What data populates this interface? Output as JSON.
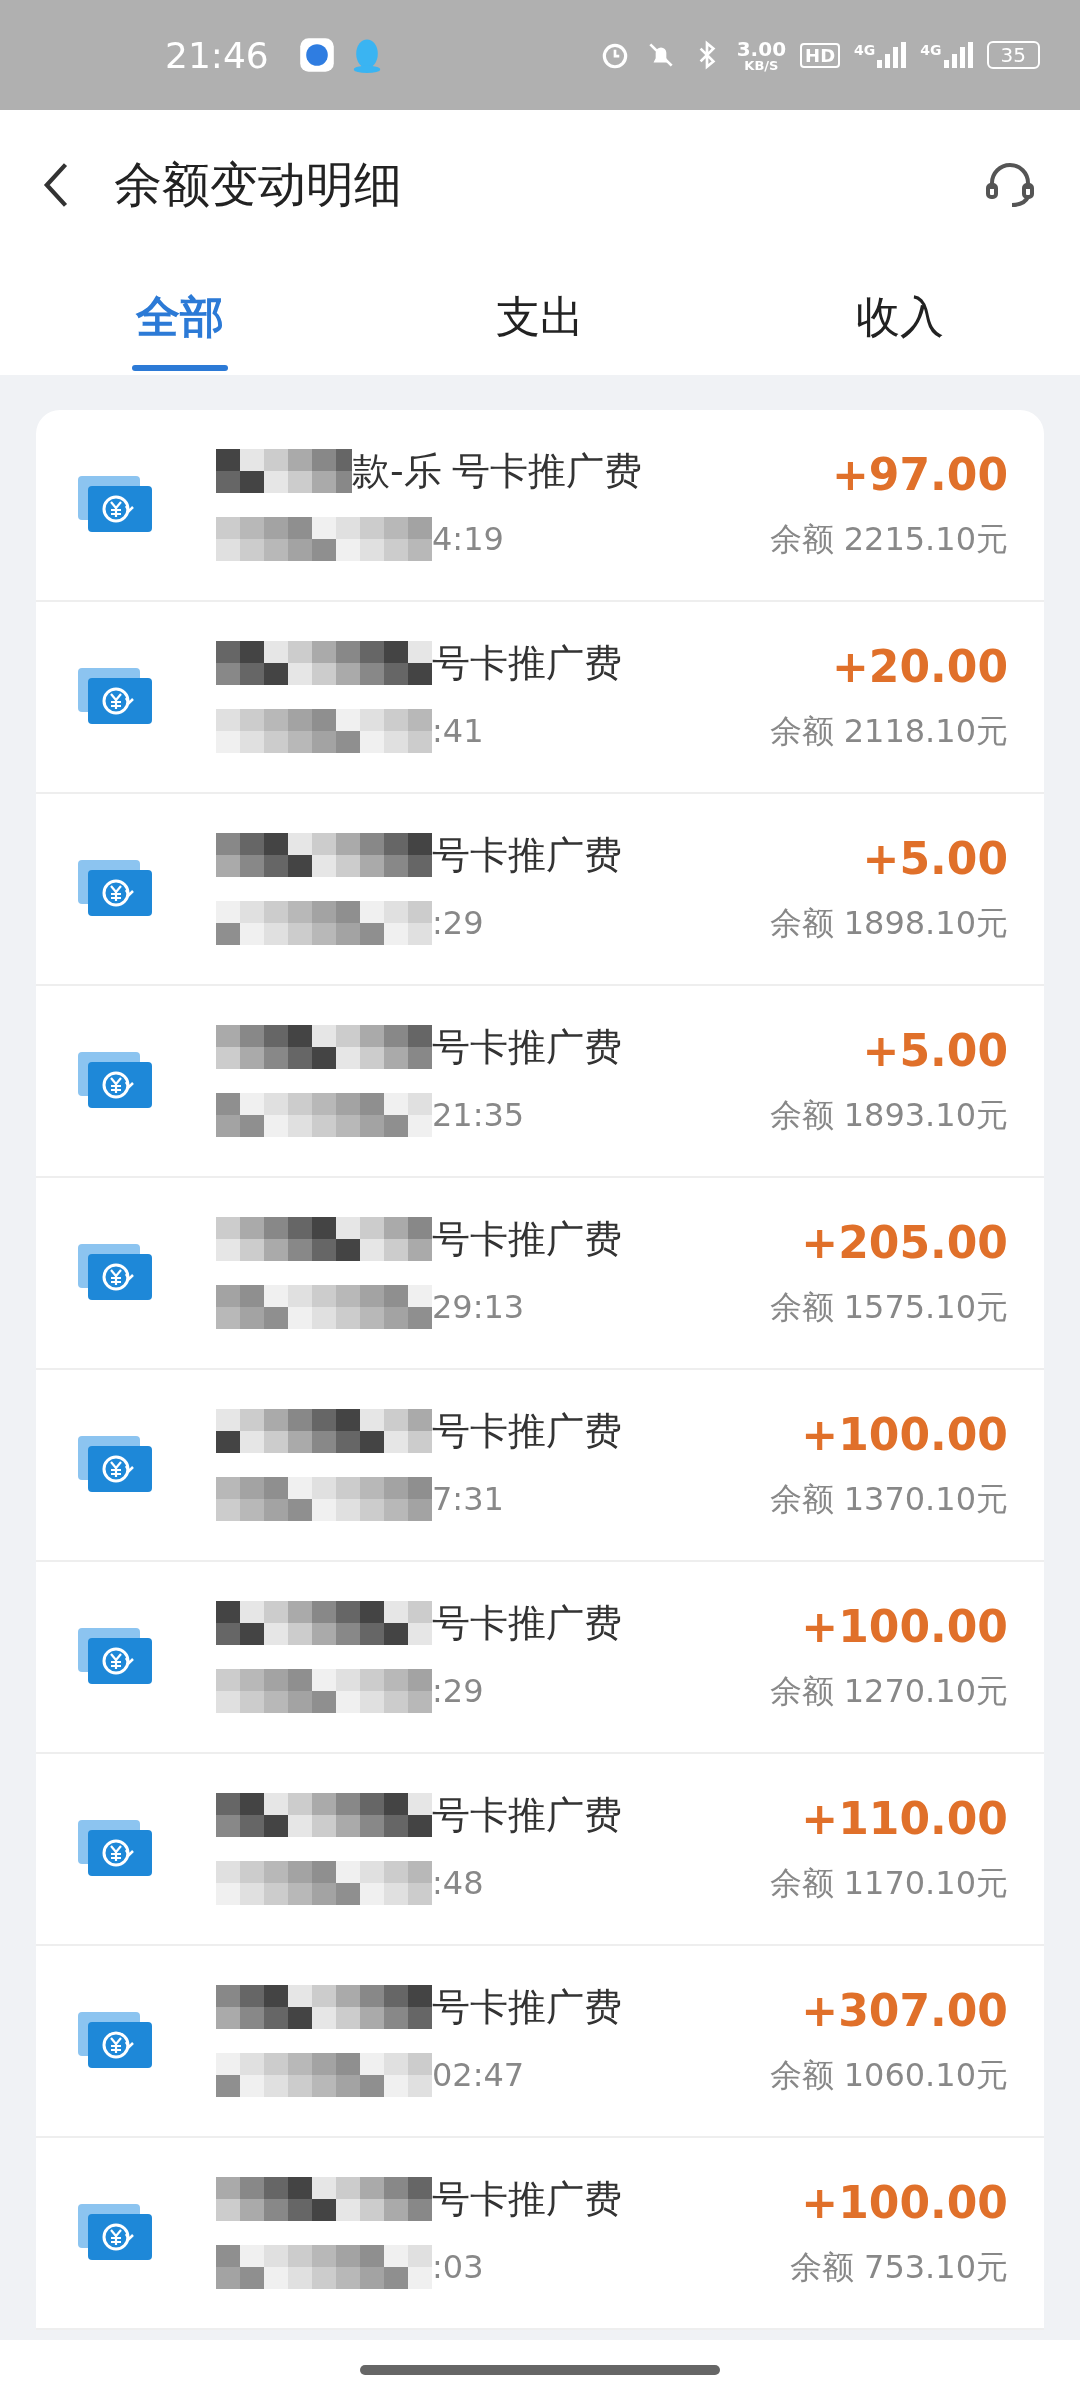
{
  "status_bar": {
    "time": "21:46",
    "net_speed": "3.00",
    "net_unit": "KB/S",
    "hd": "HD",
    "signal_1": "4G",
    "signal_2": "4G",
    "battery": "35"
  },
  "header": {
    "title": "余额变动明细"
  },
  "tabs": [
    {
      "label": "全部",
      "selected": true
    },
    {
      "label": "支出",
      "selected": false
    },
    {
      "label": "收入",
      "selected": false
    }
  ],
  "transactions": [
    {
      "title_prefix": "款-乐",
      "title": "号卡推广费",
      "time": "4:19",
      "amount": "+97.00",
      "balance": "余额 2215.10元"
    },
    {
      "title": "号卡推广费",
      "time": ":41",
      "amount": "+20.00",
      "balance": "余额 2118.10元"
    },
    {
      "title": "号卡推广费",
      "time": ":29",
      "amount": "+5.00",
      "balance": "余额 1898.10元"
    },
    {
      "title": "号卡推广费",
      "time": "21:35",
      "amount": "+5.00",
      "balance": "余额 1893.10元"
    },
    {
      "title": "号卡推广费",
      "time": "29:13",
      "amount": "+205.00",
      "balance": "余额 1575.10元"
    },
    {
      "title": "号卡推广费",
      "time": "7:31",
      "amount": "+100.00",
      "balance": "余额 1370.10元"
    },
    {
      "title": "号卡推广费",
      "time": ":29",
      "amount": "+100.00",
      "balance": "余额 1270.10元"
    },
    {
      "title": "号卡推广费",
      "time": ":48",
      "amount": "+110.00",
      "balance": "余额 1170.10元"
    },
    {
      "title": "号卡推广费",
      "time": "02:47",
      "amount": "+307.00",
      "balance": "余额 1060.10元"
    },
    {
      "title": "号卡推广费",
      "time": ":03",
      "amount": "+100.00",
      "balance": "余额 753.10元"
    }
  ]
}
